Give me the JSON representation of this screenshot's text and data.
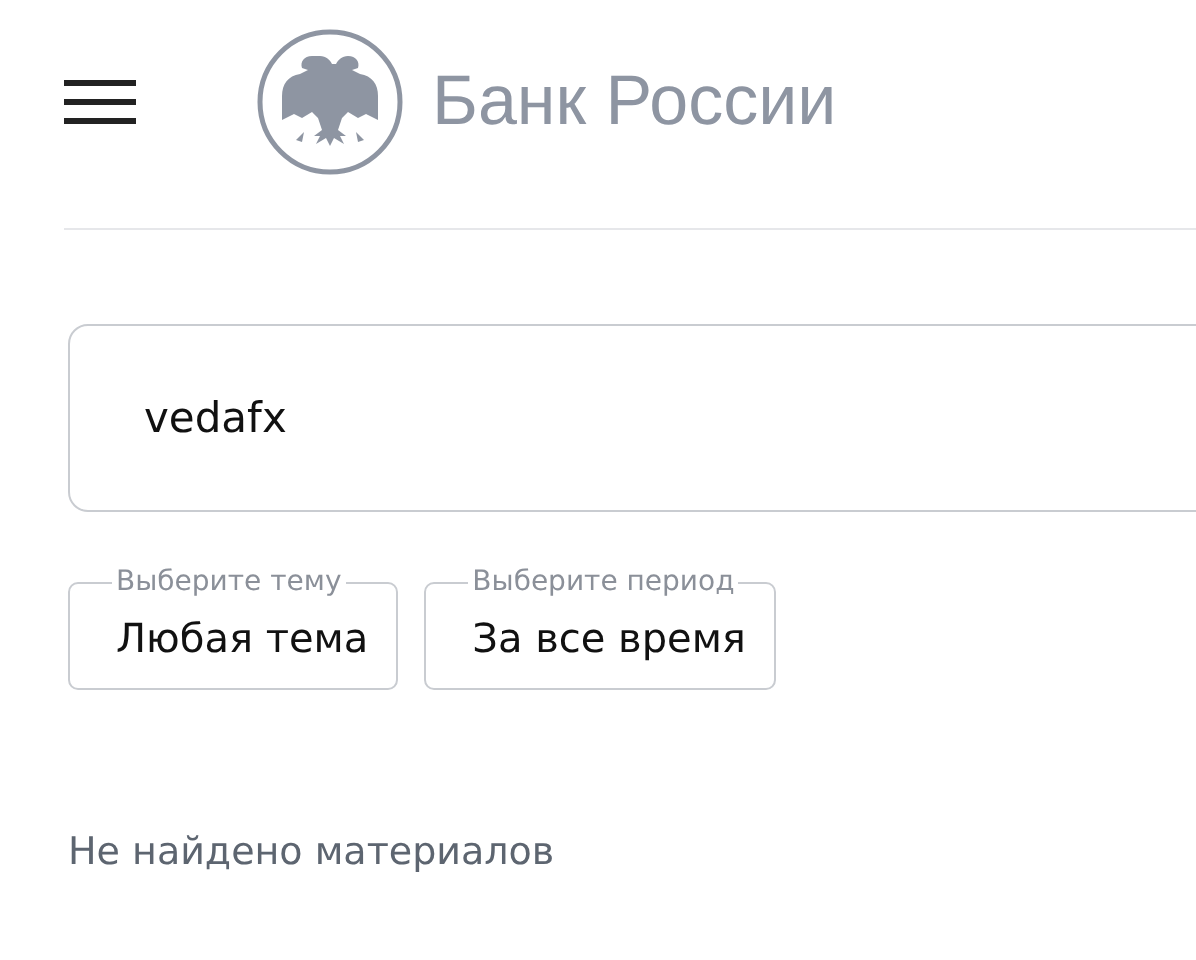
{
  "header": {
    "brand": "Банк России"
  },
  "search": {
    "value": "vedafx"
  },
  "filters": [
    {
      "label": "Выберите тему",
      "value": "Любая тема"
    },
    {
      "label": "Выберите период",
      "value": "За все время"
    }
  ],
  "message": "Не найдено материалов"
}
